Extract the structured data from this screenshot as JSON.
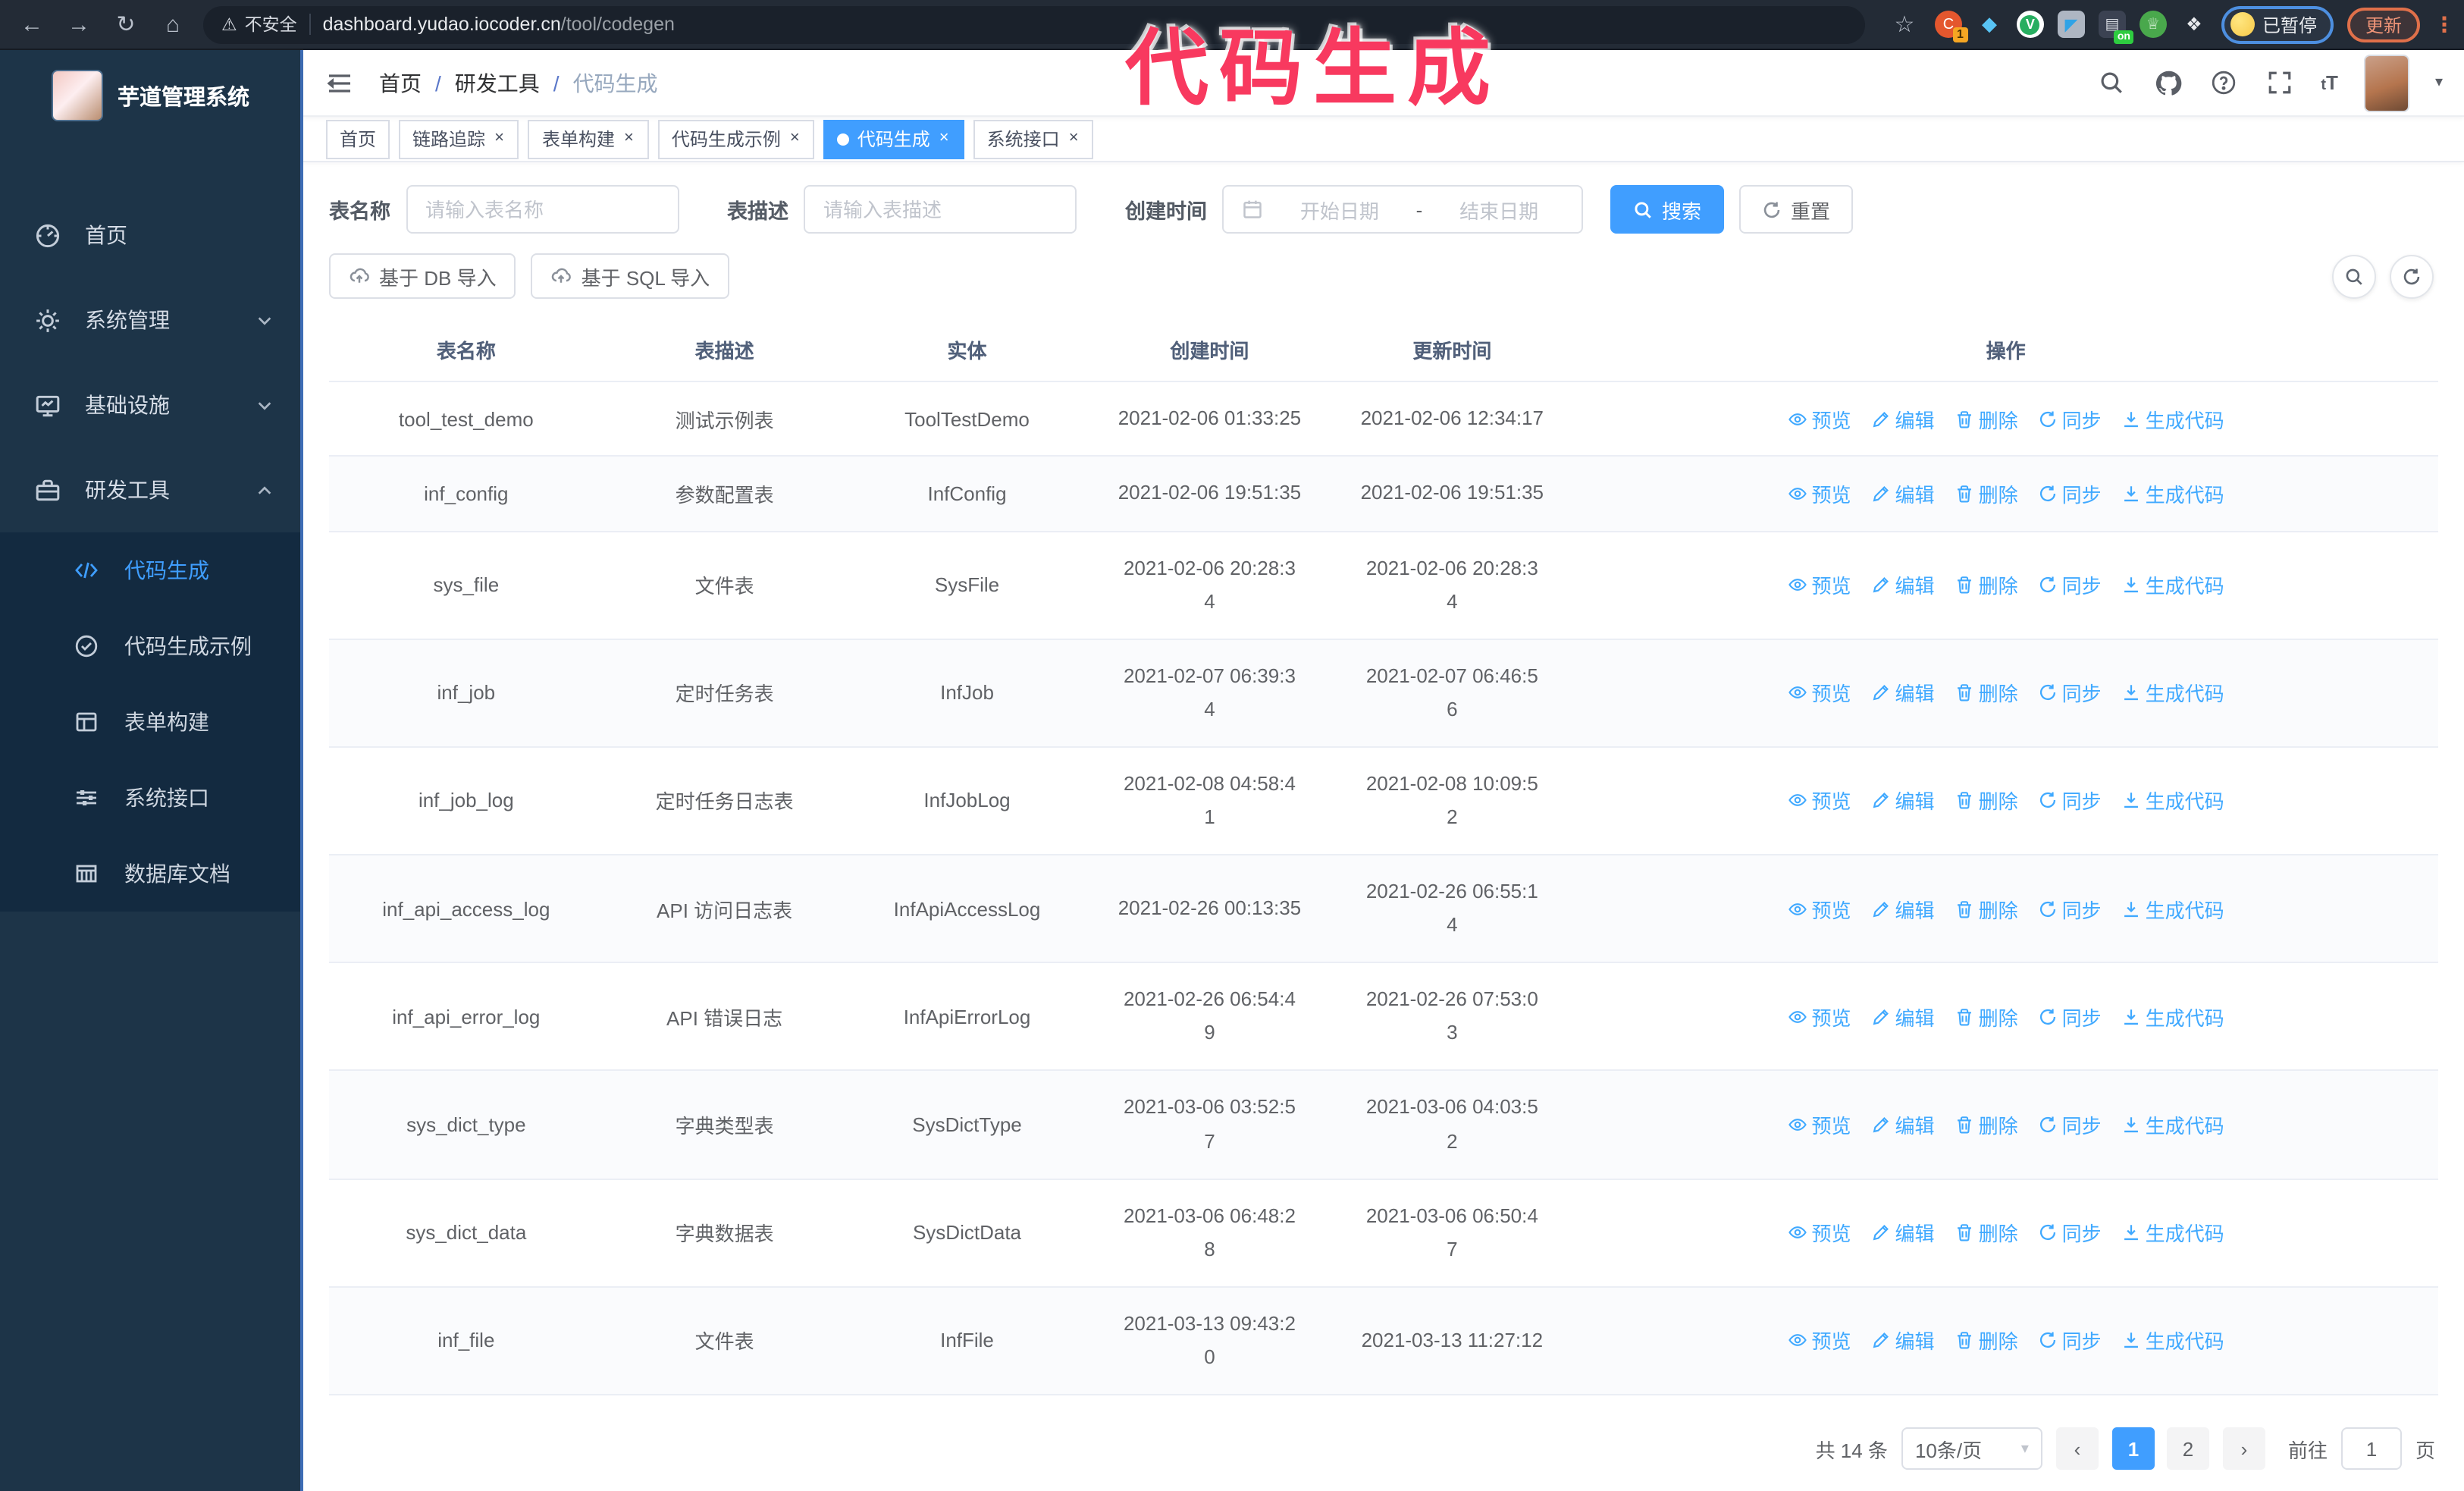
{
  "annotation": {
    "text": "代码生成",
    "color": "#f8395f"
  },
  "browser": {
    "security_label": "不安全",
    "url_host": "dashboard.yudao.iocoder.cn",
    "url_path": "/tool/codegen",
    "paused_badge": "已暂停",
    "update_button": "更新"
  },
  "sidebar": {
    "app_title": "芋道管理系统",
    "items": [
      {
        "label": "首页",
        "icon": "dashboard-icon"
      },
      {
        "label": "系统管理",
        "icon": "gear-icon"
      },
      {
        "label": "基础设施",
        "icon": "monitor-icon"
      },
      {
        "label": "研发工具",
        "icon": "toolbox-icon"
      }
    ],
    "submenu": [
      {
        "label": "代码生成",
        "icon": "code-icon",
        "active": true
      },
      {
        "label": "代码生成示例",
        "icon": "example-icon"
      },
      {
        "label": "表单构建",
        "icon": "form-icon"
      },
      {
        "label": "系统接口",
        "icon": "api-icon"
      },
      {
        "label": "数据库文档",
        "icon": "database-icon"
      }
    ]
  },
  "navbar": {
    "breadcrumb": [
      "首页",
      "研发工具",
      "代码生成"
    ]
  },
  "tabs": [
    {
      "label": "首页",
      "closable": false,
      "active": false
    },
    {
      "label": "链路追踪",
      "closable": true,
      "active": false
    },
    {
      "label": "表单构建",
      "closable": true,
      "active": false
    },
    {
      "label": "代码生成示例",
      "closable": true,
      "active": false
    },
    {
      "label": "代码生成",
      "closable": true,
      "active": true
    },
    {
      "label": "系统接口",
      "closable": true,
      "active": false
    }
  ],
  "filter": {
    "table_name_label": "表名称",
    "table_name_placeholder": "请输入表名称",
    "table_desc_label": "表描述",
    "table_desc_placeholder": "请输入表描述",
    "create_time_label": "创建时间",
    "date_start_placeholder": "开始日期",
    "date_separator": "-",
    "date_end_placeholder": "结束日期",
    "search_label": "搜索",
    "reset_label": "重置"
  },
  "toolbar": {
    "import_db_label": "基于 DB 导入",
    "import_sql_label": "基于 SQL 导入"
  },
  "table": {
    "columns": [
      "表名称",
      "表描述",
      "实体",
      "创建时间",
      "更新时间",
      "操作"
    ],
    "ops": [
      "预览",
      "编辑",
      "删除",
      "同步",
      "生成代码"
    ],
    "rows": [
      {
        "name": "tool_test_demo",
        "desc": "测试示例表",
        "entity": "ToolTestDemo",
        "created": [
          "2021-02-06 01:33:25"
        ],
        "updated": [
          "2021-02-06 12:34:17"
        ]
      },
      {
        "name": "inf_config",
        "desc": "参数配置表",
        "entity": "InfConfig",
        "created": [
          "2021-02-06 19:51:35"
        ],
        "updated": [
          "2021-02-06 19:51:35"
        ]
      },
      {
        "name": "sys_file",
        "desc": "文件表",
        "entity": "SysFile",
        "created": [
          "2021-02-06 20:28:3",
          "4"
        ],
        "updated": [
          "2021-02-06 20:28:3",
          "4"
        ]
      },
      {
        "name": "inf_job",
        "desc": "定时任务表",
        "entity": "InfJob",
        "created": [
          "2021-02-07 06:39:3",
          "4"
        ],
        "updated": [
          "2021-02-07 06:46:5",
          "6"
        ]
      },
      {
        "name": "inf_job_log",
        "desc": "定时任务日志表",
        "entity": "InfJobLog",
        "created": [
          "2021-02-08 04:58:4",
          "1"
        ],
        "updated": [
          "2021-02-08 10:09:5",
          "2"
        ]
      },
      {
        "name": "inf_api_access_log",
        "desc": "API 访问日志表",
        "entity": "InfApiAccessLog",
        "created": [
          "2021-02-26 00:13:35"
        ],
        "updated": [
          "2021-02-26 06:55:1",
          "4"
        ]
      },
      {
        "name": "inf_api_error_log",
        "desc": "API 错误日志",
        "entity": "InfApiErrorLog",
        "created": [
          "2021-02-26 06:54:4",
          "9"
        ],
        "updated": [
          "2021-02-26 07:53:0",
          "3"
        ]
      },
      {
        "name": "sys_dict_type",
        "desc": "字典类型表",
        "entity": "SysDictType",
        "created": [
          "2021-03-06 03:52:5",
          "7"
        ],
        "updated": [
          "2021-03-06 04:03:5",
          "2"
        ]
      },
      {
        "name": "sys_dict_data",
        "desc": "字典数据表",
        "entity": "SysDictData",
        "created": [
          "2021-03-06 06:48:2",
          "8"
        ],
        "updated": [
          "2021-03-06 06:50:4",
          "7"
        ]
      },
      {
        "name": "inf_file",
        "desc": "文件表",
        "entity": "InfFile",
        "created": [
          "2021-03-13 09:43:2",
          "0"
        ],
        "updated": [
          "2021-03-13 11:27:12"
        ]
      }
    ]
  },
  "pagination": {
    "total_text": "共 14 条",
    "page_size": "10条/页",
    "pages": [
      "1",
      "2"
    ],
    "active_page": "1",
    "goto_label": "前往",
    "goto_value": "1",
    "goto_suffix": "页"
  },
  "colors": {
    "accent": "#409eff",
    "link": "#40a9ff",
    "sidebar_bg": "#1d3448",
    "submenu_bg": "#132a40",
    "annotation": "#f8395f"
  }
}
